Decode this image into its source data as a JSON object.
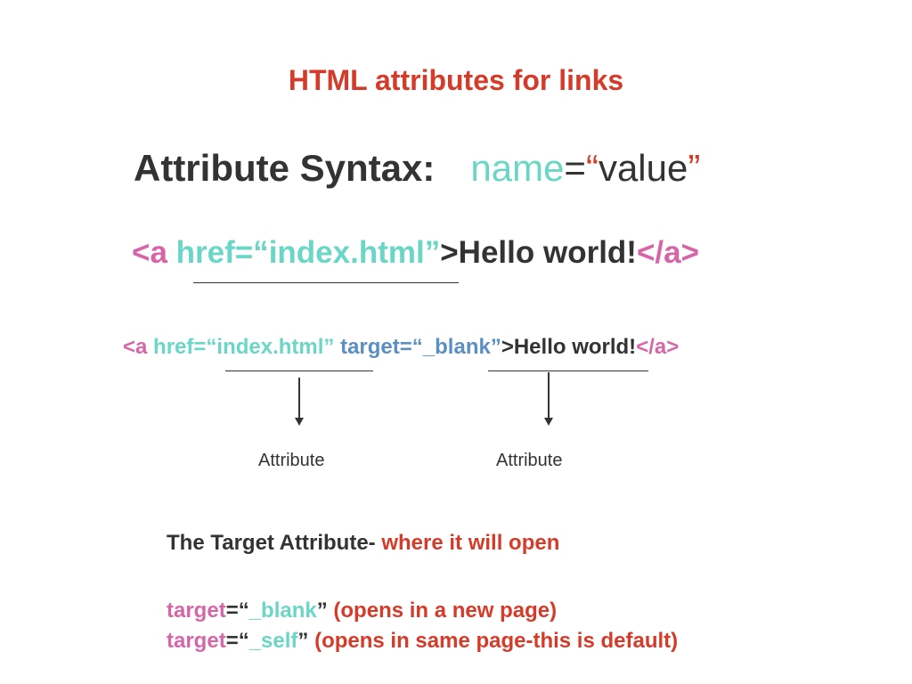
{
  "colors": {
    "red": "#d63b2a",
    "teal": "#6ad7c6",
    "pink": "#d766a8",
    "blue": "#5b8fc3",
    "dark": "#333333"
  },
  "title": "HTML attributes for links",
  "syntax": {
    "label": "Attribute Syntax:",
    "name": "name",
    "equals": "=",
    "open_quote": "“",
    "value": "value",
    "close_quote": "”"
  },
  "example1": {
    "open_tag": "<a",
    "href_attr": "href=“index.html”",
    "close_bracket": ">",
    "text": "Hello world!",
    "end_tag": "</a>"
  },
  "example2": {
    "open_tag": "<a",
    "href_attr": "href=“index.html”",
    "target_attr": "target=“_blank”",
    "close_bracket": ">",
    "text": "Hello world!",
    "end_tag": "</a>"
  },
  "labels": {
    "attribute_left": "Attribute",
    "attribute_right": "Attribute"
  },
  "target_section": {
    "heading": "The Target Attribute-",
    "heading_note": "where it will open",
    "items": [
      {
        "key": "target",
        "equals": "=",
        "open_quote": "“",
        "value": "_blank",
        "close_quote": "”",
        "note": "(opens in a new page)"
      },
      {
        "key": "target",
        "equals": "=",
        "open_quote": "“",
        "value": "_self",
        "close_quote": "”",
        "note": "(opens in same page-this is default)"
      }
    ]
  }
}
